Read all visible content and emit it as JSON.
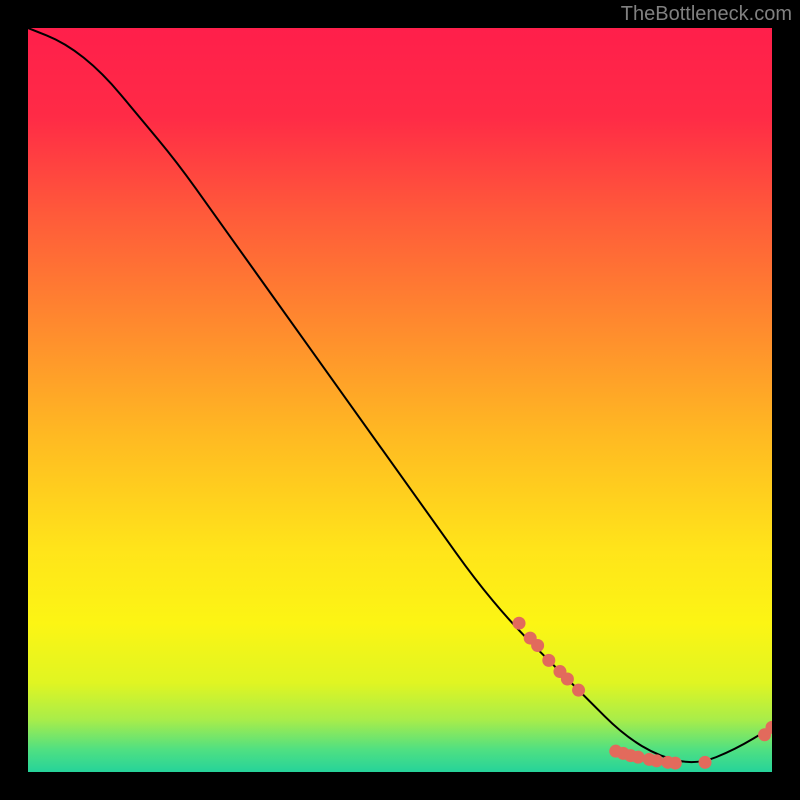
{
  "watermark": "TheBottleneck.com",
  "chart_data": {
    "type": "line",
    "title": "",
    "xlabel": "",
    "ylabel": "",
    "xlim": [
      0,
      100
    ],
    "ylim": [
      0,
      100
    ],
    "x": [
      0,
      5,
      10,
      15,
      20,
      25,
      30,
      35,
      40,
      45,
      50,
      55,
      60,
      65,
      70,
      75,
      80,
      85,
      90,
      95,
      100
    ],
    "values": [
      100,
      98,
      94,
      88,
      82,
      75,
      68,
      61,
      54,
      47,
      40,
      33,
      26,
      20,
      15,
      10,
      5,
      2,
      1,
      3,
      6
    ],
    "marker_cluster_1": {
      "comment": "descending segment markers (upper cluster)",
      "points": [
        {
          "x": 66,
          "y": 20
        },
        {
          "x": 67.5,
          "y": 18
        },
        {
          "x": 68.5,
          "y": 17
        },
        {
          "x": 70,
          "y": 15
        },
        {
          "x": 71.5,
          "y": 13.5
        },
        {
          "x": 72.5,
          "y": 12.5
        },
        {
          "x": 74,
          "y": 11
        }
      ]
    },
    "marker_cluster_2": {
      "comment": "trough markers (lower cluster)",
      "points": [
        {
          "x": 79,
          "y": 2.8
        },
        {
          "x": 80,
          "y": 2.5
        },
        {
          "x": 81,
          "y": 2.2
        },
        {
          "x": 82,
          "y": 2.0
        },
        {
          "x": 83.5,
          "y": 1.7
        },
        {
          "x": 84.5,
          "y": 1.5
        },
        {
          "x": 86,
          "y": 1.3
        },
        {
          "x": 87,
          "y": 1.2
        },
        {
          "x": 91,
          "y": 1.3
        }
      ]
    },
    "marker_cluster_3": {
      "comment": "rising tail markers (right edge)",
      "points": [
        {
          "x": 99,
          "y": 5
        },
        {
          "x": 100,
          "y": 6
        }
      ]
    },
    "gradient_stops": [
      {
        "pos": 0.0,
        "color": "#ff1f4b"
      },
      {
        "pos": 0.12,
        "color": "#ff2b46"
      },
      {
        "pos": 0.25,
        "color": "#ff5a3a"
      },
      {
        "pos": 0.4,
        "color": "#ff8a2e"
      },
      {
        "pos": 0.55,
        "color": "#ffba22"
      },
      {
        "pos": 0.7,
        "color": "#ffe41a"
      },
      {
        "pos": 0.8,
        "color": "#fcf514"
      },
      {
        "pos": 0.88,
        "color": "#e0f522"
      },
      {
        "pos": 0.93,
        "color": "#a8ed4a"
      },
      {
        "pos": 0.97,
        "color": "#4fe082"
      },
      {
        "pos": 1.0,
        "color": "#26d39a"
      }
    ],
    "curve_color": "#000000",
    "marker_color": "#e26a5c"
  }
}
